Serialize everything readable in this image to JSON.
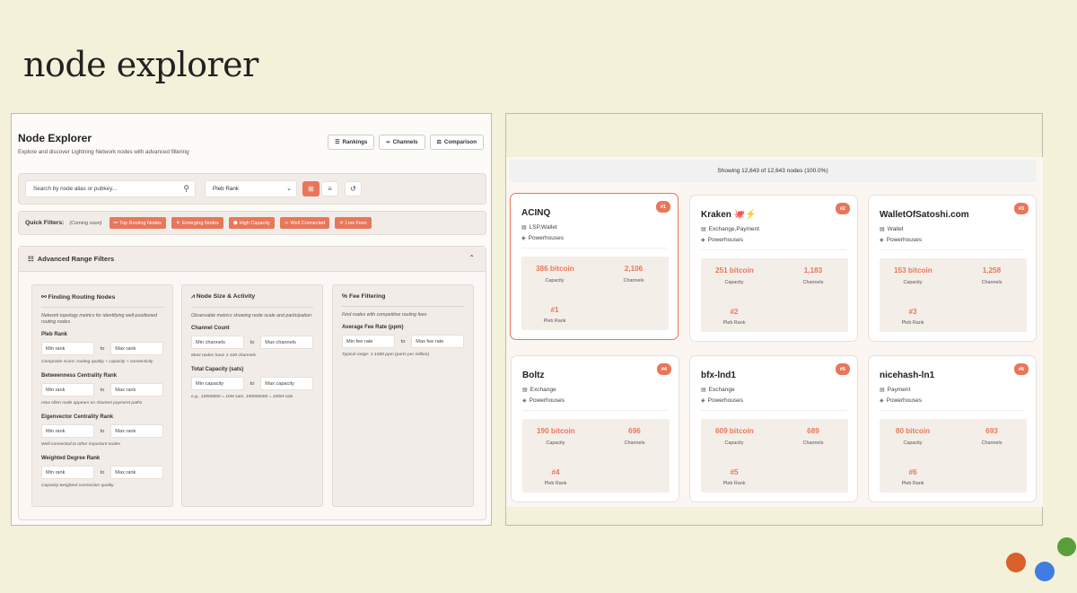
{
  "slide_title": "node explorer",
  "explorer": {
    "title": "Node Explorer",
    "subtitle": "Explore and discover Lightning Network nodes with advanced filtering",
    "buttons": {
      "rankings": "Rankings",
      "channels": "Channels",
      "comparison": "Comparison"
    },
    "search": {
      "placeholder": "Search by node alias or pubkey...",
      "sort_value": "Pleb Rank"
    },
    "quick_filters": {
      "label": "Quick Filters:",
      "soon": "(Coming soon)",
      "items": [
        "Top Routing Nodes",
        "Emerging Nodes",
        "High Capacity",
        "Well Connected",
        "Low Fees"
      ]
    },
    "advanced": {
      "title": "Advanced Range Filters",
      "routing": {
        "title": "Finding Routing Nodes",
        "desc": "Network topology metrics for identifying well-positioned routing nodes",
        "groups": [
          {
            "label": "Pleb Rank",
            "min": "Min rank",
            "max": "Max rank",
            "hint": "Composite score: routing quality + capacity + connectivity"
          },
          {
            "label": "Betweenness Centrality Rank",
            "min": "Min rank",
            "max": "Max rank",
            "hint": "How often node appears on shortest payment paths"
          },
          {
            "label": "Eigenvector Centrality Rank",
            "min": "Min rank",
            "max": "Max rank",
            "hint": "Well-connected to other important nodes"
          },
          {
            "label": "Weighted Degree Rank",
            "min": "Min rank",
            "max": "Max rank",
            "hint": "Capacity-weighted connection quality"
          }
        ]
      },
      "size": {
        "title": "Node Size & Activity",
        "desc": "Observable metrics showing node scale and participation",
        "groups": [
          {
            "label": "Channel Count",
            "min": "Min channels",
            "max": "Max channels",
            "hint": "Most nodes have 1-100 channels"
          },
          {
            "label": "Total Capacity (sats)",
            "min": "Min capacity",
            "max": "Max capacity",
            "hint": "e.g., 10000000 = 10M sats, 100000000 = 100M sats"
          }
        ]
      },
      "fees": {
        "title": "Fee Filtering",
        "desc": "Find nodes with competitive routing fees",
        "groups": [
          {
            "label": "Average Fee Rate (ppm)",
            "min": "Min fee rate",
            "max": "Max fee rate",
            "hint": "Typical range: 1-1000 ppm (parts per million)"
          }
        ]
      },
      "to": "to"
    }
  },
  "results": {
    "showing": "Showing 12,643 of 12,643 nodes (100.0%)",
    "labels": {
      "capacity": "Capacity",
      "channels": "Channels",
      "rank": "Pleb Rank"
    },
    "nodes": [
      {
        "badge": "#1",
        "name": "ACINQ",
        "type": "LSP,Wallet",
        "category": "Powerhouses",
        "capacity": "386 bitcoin",
        "channels": "2,106",
        "rank": "#1"
      },
      {
        "badge": "#2",
        "name": "Kraken 🐙⚡",
        "type": "Exchange,Payment",
        "category": "Powerhouses",
        "capacity": "251 bitcoin",
        "channels": "1,183",
        "rank": "#2"
      },
      {
        "badge": "#3",
        "name": "WalletOfSatoshi.com",
        "type": "Wallet",
        "category": "Powerhouses",
        "capacity": "153 bitcoin",
        "channels": "1,258",
        "rank": "#3"
      },
      {
        "badge": "#4",
        "name": "Boltz",
        "type": "Exchange",
        "category": "Powerhouses",
        "capacity": "190 bitcoin",
        "channels": "696",
        "rank": "#4"
      },
      {
        "badge": "#5",
        "name": "bfx-lnd1",
        "type": "Exchange",
        "category": "Powerhouses",
        "capacity": "609 bitcoin",
        "channels": "689",
        "rank": "#5"
      },
      {
        "badge": "#6",
        "name": "nicehash-ln1",
        "type": "Payment",
        "category": "Powerhouses",
        "capacity": "80 bitcoin",
        "channels": "693",
        "rank": "#6"
      }
    ]
  },
  "colors": {
    "accent": "#e8775a",
    "dot_orange": "#d9602b",
    "dot_blue": "#3f7de0",
    "dot_green": "#5a9e3c"
  }
}
